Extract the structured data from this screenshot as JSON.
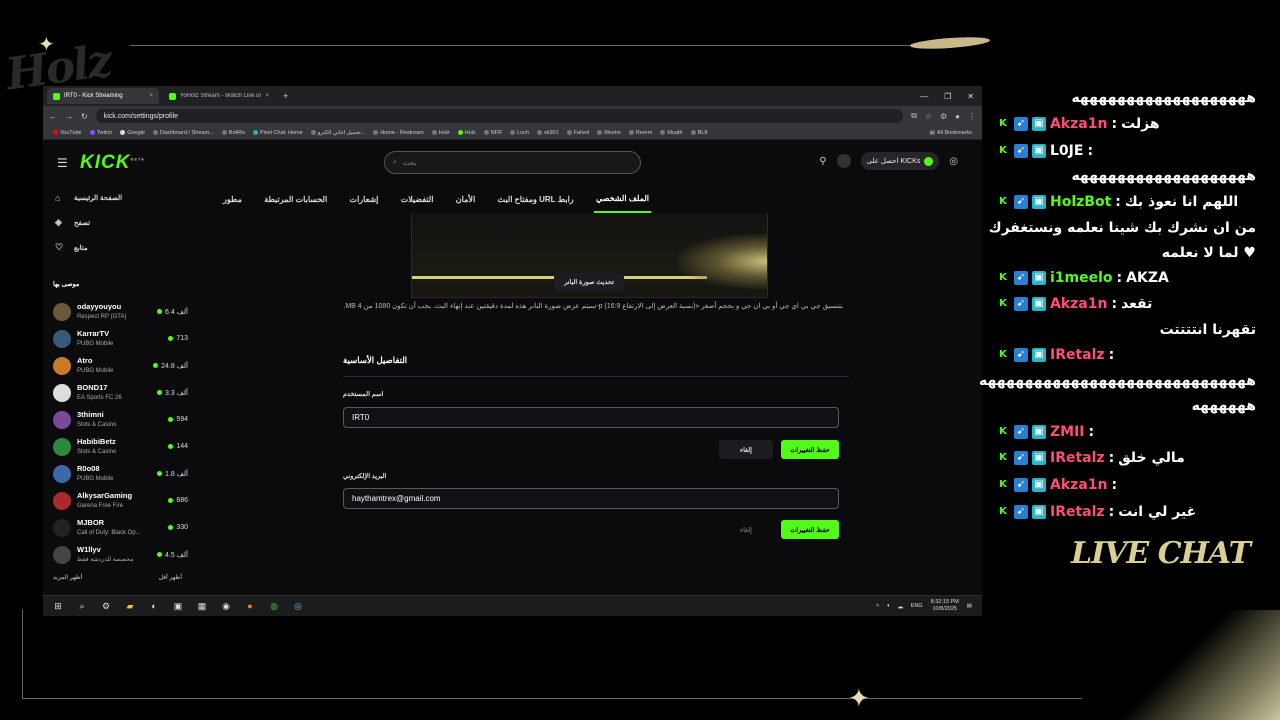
{
  "browser": {
    "tabs": [
      {
        "label": "IRT0 - Kick Streaming",
        "active": true
      },
      {
        "label": "YoHolz Stream - Watch Live on",
        "active": false
      }
    ],
    "url": "kick.com/settings/profile",
    "bookmarks": [
      "YouTube",
      "Twitch",
      "Google",
      "Dashboard / Stream...",
      "BotRix",
      "Pixel Chat: Home",
      "تحميل اغاني الكترو...",
      "Home - Restream",
      "Holz",
      "Holz",
      "NFR",
      "Loch",
      "sk901",
      "Fahed",
      "Mesho",
      "Reerm",
      "Muath",
      "BL8"
    ],
    "all_bookmarks": "All Bookmarks"
  },
  "kick": {
    "logo": "KICK",
    "logo_sup": "BETA",
    "search_placeholder": "بحث",
    "get_kicks": "احصل على KICKs",
    "sidebar": {
      "links": [
        {
          "label": "الصفحة الرئيسية",
          "icon": "home-icon"
        },
        {
          "label": "تصفح",
          "icon": "compass-icon"
        },
        {
          "label": "متابع",
          "icon": "heart-icon"
        }
      ],
      "section_title": "موصى بها",
      "channels": [
        {
          "name": "odayyouyou",
          "category": "Respect RP (GTA)",
          "viewers": "6.4 ألف",
          "color": "#6a5a3a"
        },
        {
          "name": "KarrarTV",
          "category": "PUBG Mobile",
          "viewers": "713",
          "color": "#3a5a7a"
        },
        {
          "name": "Atro",
          "category": "PUBG Mobile",
          "viewers": "24.8 ألف",
          "color": "#c87a2a"
        },
        {
          "name": "BOND17",
          "category": "EA Sports FC 26",
          "viewers": "3.3 ألف",
          "color": "#ddd"
        },
        {
          "name": "3thimni",
          "category": "Slots & Casino",
          "viewers": "594",
          "color": "#7a4a9a"
        },
        {
          "name": "HabibiBetz",
          "category": "Slots & Casino",
          "viewers": "144",
          "color": "#2a8a3a"
        },
        {
          "name": "R0o08",
          "category": "PUBG Mobile",
          "viewers": "1.8 ألف",
          "color": "#3a6aaa"
        },
        {
          "name": "AlkysarGaming",
          "category": "Garena Free Fire",
          "viewers": "686",
          "color": "#aa2a2a"
        },
        {
          "name": "MJBOR",
          "category": "Call of Duty: Black Op...",
          "viewers": "330",
          "color": "#222"
        },
        {
          "name": "W1llyv",
          "category": "مخصصة للدردشة فقط",
          "viewers": "4.5 ألف",
          "color": "#444"
        }
      ],
      "show_more": "أظهر المزيد",
      "show_less": "أظهر أقل"
    },
    "settings_tabs": [
      "الملف الشخصي",
      "رابط URL ومفتاح البث",
      "الأمان",
      "التفضيلات",
      "إشعارات",
      "الحسابات المرتبطة",
      "مطور"
    ],
    "banner": {
      "update_button": "تحديث صورة البانر",
      "note": "بتنسيق جي بي اي جي أو بي ان جي و بحجم أصغر «(نسبة العرض إلى الارتفاع 16:9) p-سيتم عرض صورة البانر هذه لمدة دقيقتين عند إنهاء البث. يجب أن تكون 1080 من 4 MB."
    },
    "basic_details": {
      "title": "التفاصيل الأساسية",
      "username_label": "اسم المستخدم",
      "username_value": "IRT0",
      "email_label": "البريد الإلكتروني",
      "email_value": "haythamtrex@gmail.com",
      "save_label": "حفظ التغييرات",
      "cancel_label": "إلغاء"
    }
  },
  "taskbar": {
    "lang": "ENG",
    "time": "8:32:15 PM",
    "date": "10/8/2025"
  },
  "chat": {
    "messages": [
      {
        "text": "هههههههههههههههههههه"
      },
      {
        "user": "Akza1n",
        "user_color": "#ff4d7a",
        "text": "هزلت"
      },
      {
        "user": "L0JE",
        "user_color": "#fff",
        "text": ""
      },
      {
        "text": "هههههههههههههههههههه"
      },
      {
        "user": "HolzBot",
        "user_color": "#53fc18",
        "text": "اللهم انا نعوذ بك"
      },
      {
        "text": "من ان نشرك بك شينا نعلمه ونستغفرك"
      },
      {
        "text": "لما لا نعلمه ♥"
      },
      {
        "user": "i1meelo",
        "user_color": "#53fc18",
        "text": "AKZA"
      },
      {
        "user": "Akza1n",
        "user_color": "#ff4d7a",
        "text": "تقعد"
      },
      {
        "text": "تقهرنا انتتتتت"
      },
      {
        "user": "IRetalz",
        "user_color": "#ff4d7a",
        "text": ""
      },
      {
        "text": "هههههههههههههههههههههههههههههه"
      },
      {
        "text": "ههههههه"
      },
      {
        "user": "ZMII",
        "user_color": "#ff4d7a",
        "text": ""
      },
      {
        "user": "IRetalz",
        "user_color": "#ff4d7a",
        "text": "مالي خلق"
      },
      {
        "user": "Akza1n",
        "user_color": "#ff4d7a",
        "text": ""
      },
      {
        "user": "IRetalz",
        "user_color": "#ff4d7a",
        "text": "غير لي انت"
      }
    ],
    "label": "LIVE CHAT"
  },
  "overlay": {
    "logo_text": "Holz"
  }
}
